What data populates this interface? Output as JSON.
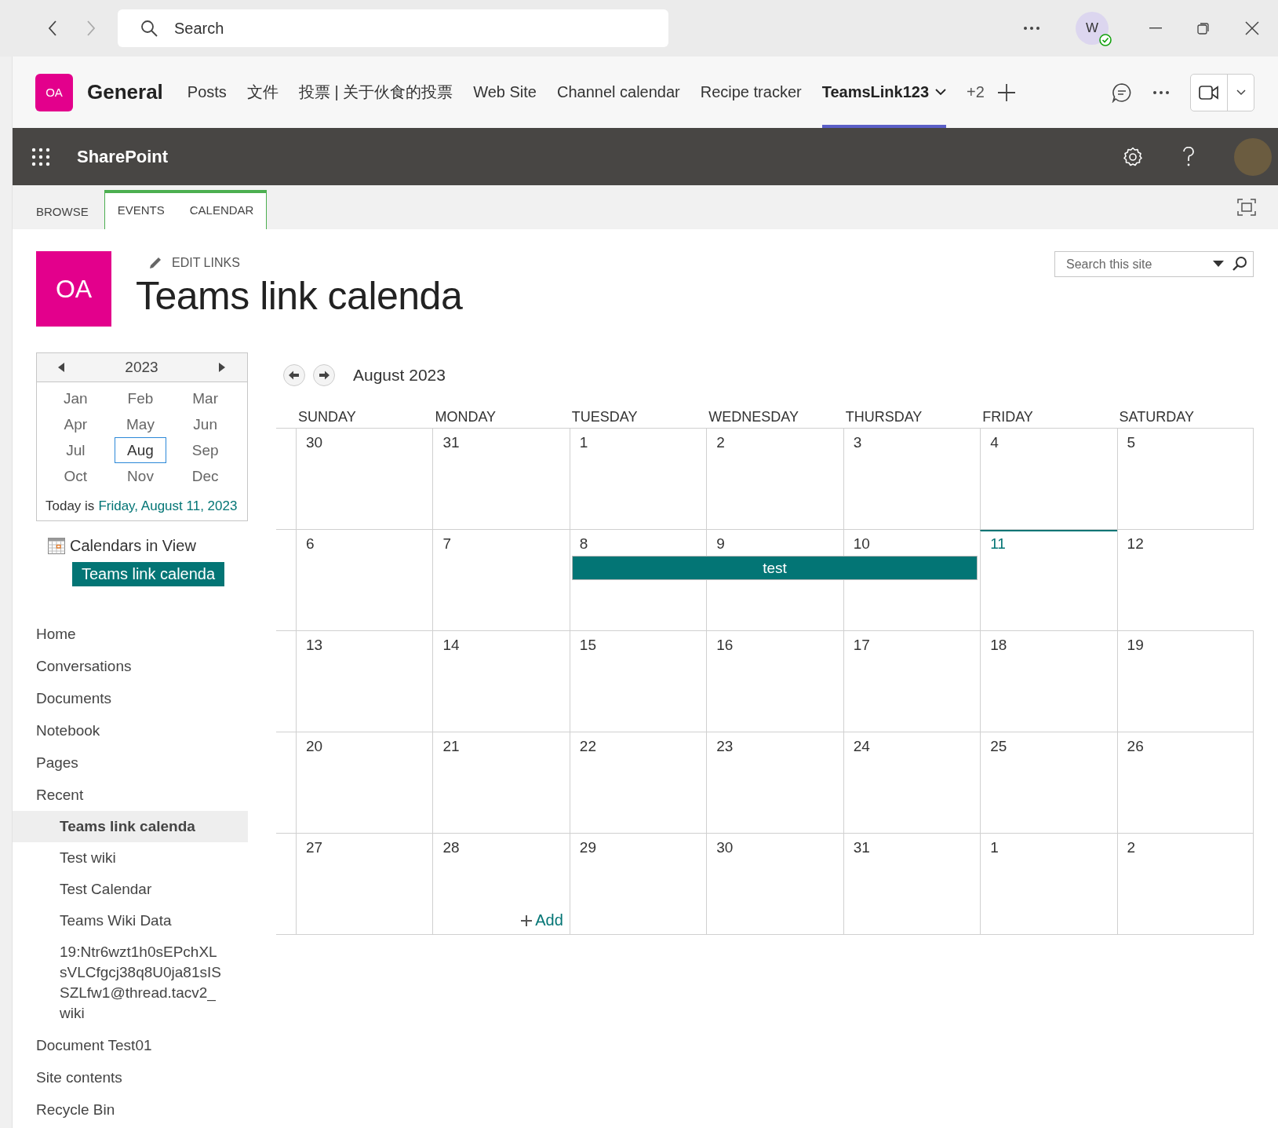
{
  "titlebar": {
    "search": {
      "placeholder": "Search"
    },
    "avatar": "W",
    "presence_ok": true
  },
  "teams_header": {
    "badge": "OA",
    "channel": "General",
    "tabs": [
      {
        "label": "Posts",
        "selected": false,
        "dropdown": false
      },
      {
        "label": "文件",
        "selected": false,
        "dropdown": false
      },
      {
        "label": "投票 | 关于伙食的投票",
        "selected": false,
        "dropdown": false
      },
      {
        "label": "Web Site",
        "selected": false,
        "dropdown": false
      },
      {
        "label": "Channel calendar",
        "selected": false,
        "dropdown": false
      },
      {
        "label": "Recipe tracker",
        "selected": false,
        "dropdown": false
      },
      {
        "label": "TeamsLink123",
        "selected": true,
        "dropdown": true
      }
    ],
    "more_tabs": "+2"
  },
  "suite_bar": {
    "title": "SharePoint"
  },
  "ribbon": {
    "tabs": [
      {
        "label": "BROWSE",
        "contextual": false
      },
      {
        "label": "EVENTS",
        "contextual": true
      },
      {
        "label": "CALENDAR",
        "contextual": true
      }
    ]
  },
  "site": {
    "logo": "OA",
    "edit_links": "EDIT LINKS",
    "title": "Teams link calenda",
    "search": {
      "placeholder": "Search this site"
    }
  },
  "date_picker": {
    "year": "2023",
    "months": [
      {
        "label": "Jan",
        "selected": false
      },
      {
        "label": "Feb",
        "selected": false
      },
      {
        "label": "Mar",
        "selected": false
      },
      {
        "label": "Apr",
        "selected": false
      },
      {
        "label": "May",
        "selected": false
      },
      {
        "label": "Jun",
        "selected": false
      },
      {
        "label": "Jul",
        "selected": false
      },
      {
        "label": "Aug",
        "selected": true
      },
      {
        "label": "Sep",
        "selected": false
      },
      {
        "label": "Oct",
        "selected": false
      },
      {
        "label": "Nov",
        "selected": false
      },
      {
        "label": "Dec",
        "selected": false
      }
    ],
    "today_label": "Today is",
    "today_value": "Friday, August 11, 2023"
  },
  "calendars_in_view": {
    "label": "Calendars in View",
    "items": [
      "Teams link calenda"
    ]
  },
  "nav": {
    "items": [
      {
        "label": "Home",
        "selected": false
      },
      {
        "label": "Conversations",
        "selected": false
      },
      {
        "label": "Documents",
        "selected": false
      },
      {
        "label": "Notebook",
        "selected": false
      },
      {
        "label": "Pages",
        "selected": false
      },
      {
        "label": "Recent",
        "selected": false,
        "children": [
          {
            "label": "Teams link calenda",
            "selected": true
          },
          {
            "label": "Test wiki",
            "selected": false
          },
          {
            "label": "Test Calendar",
            "selected": false
          },
          {
            "label": "Teams Wiki Data",
            "selected": false
          },
          {
            "label": "19:Ntr6wzt1h0sEPchXLsVLCfgcj38q8U0ja81sISSZLfw1@thread.tacv2_wiki",
            "selected": false
          }
        ]
      },
      {
        "label": "Document Test01",
        "selected": false
      },
      {
        "label": "Site contents",
        "selected": false
      },
      {
        "label": "Recycle Bin",
        "selected": false
      }
    ]
  },
  "calendar": {
    "title": "August 2023",
    "weekdays": [
      "SUNDAY",
      "MONDAY",
      "TUESDAY",
      "WEDNESDAY",
      "THURSDAY",
      "FRIDAY",
      "SATURDAY"
    ],
    "weeks": [
      {
        "days": [
          {
            "label": "30",
            "today": false
          },
          {
            "label": "31",
            "today": false
          },
          {
            "label": "1",
            "today": false
          },
          {
            "label": "2",
            "today": false
          },
          {
            "label": "3",
            "today": false
          },
          {
            "label": "4",
            "today": false
          },
          {
            "label": "5",
            "today": false
          }
        ]
      },
      {
        "days": [
          {
            "label": "6",
            "today": false
          },
          {
            "label": "7",
            "today": false
          },
          {
            "label": "8",
            "today": false
          },
          {
            "label": "9",
            "today": false
          },
          {
            "label": "10",
            "today": false
          },
          {
            "label": "11",
            "today": true
          },
          {
            "label": "12",
            "today": false
          }
        ],
        "events": [
          {
            "title": "test",
            "days": [
              false,
              false,
              true,
              true,
              true,
              false,
              false
            ]
          }
        ]
      },
      {
        "days": [
          {
            "label": "13",
            "today": false
          },
          {
            "label": "14",
            "today": false
          },
          {
            "label": "15",
            "today": false
          },
          {
            "label": "16",
            "today": false
          },
          {
            "label": "17",
            "today": false
          },
          {
            "label": "18",
            "today": false
          },
          {
            "label": "19",
            "today": false
          }
        ]
      },
      {
        "days": [
          {
            "label": "20",
            "today": false
          },
          {
            "label": "21",
            "today": false
          },
          {
            "label": "22",
            "today": false
          },
          {
            "label": "23",
            "today": false
          },
          {
            "label": "24",
            "today": false
          },
          {
            "label": "25",
            "today": false
          },
          {
            "label": "26",
            "today": false
          }
        ]
      },
      {
        "days": [
          {
            "label": "27",
            "today": false
          },
          {
            "label": "28",
            "today": false,
            "add": "Add"
          },
          {
            "label": "29",
            "today": false
          },
          {
            "label": "30",
            "today": false
          },
          {
            "label": "31",
            "today": false
          },
          {
            "label": "1",
            "today": false
          },
          {
            "label": "2",
            "today": false
          }
        ]
      }
    ]
  }
}
